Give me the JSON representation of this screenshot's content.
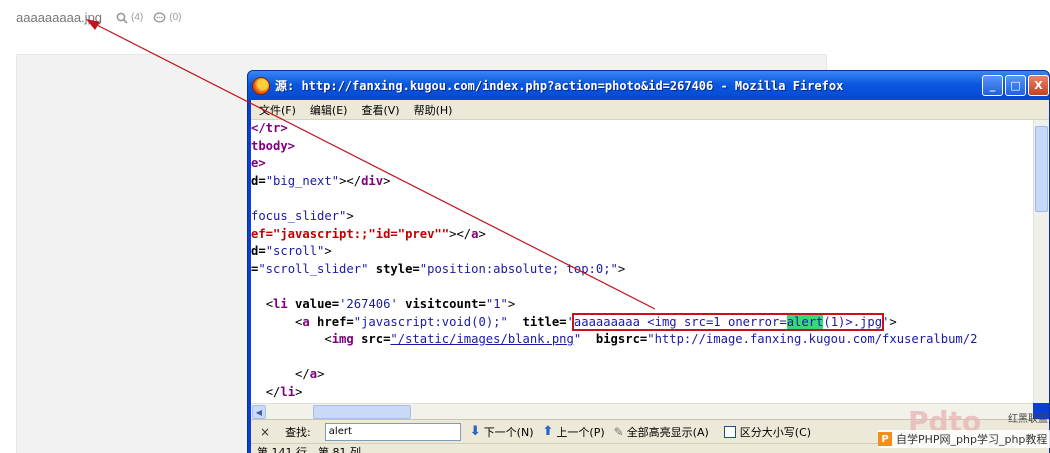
{
  "page": {
    "title": "aaaaaaaaa.jpg",
    "views_count": "(4)",
    "comments_count": "(0)"
  },
  "window": {
    "title": "源: http://fanxing.kugou.com/index.php?action=photo&id=267406 - Mozilla Firefox",
    "minimize_label": "_",
    "maximize_label": "□",
    "close_label": "X",
    "menu": [
      "文件(F)",
      "编辑(E)",
      "查看(V)",
      "帮助(H)"
    ]
  },
  "source": {
    "l1_tag": "</tr>",
    "l2_tag": "tbody>",
    "l3_tag": "e>",
    "l4_a": "d=",
    "l4_b": "\"big_next\"",
    "l4_c": "></",
    "l4_d": "div",
    "l4_e": ">",
    "l5_a": "focus_slider\"",
    "l5_b": ">",
    "l6_a": "ef=\"javascript:;\"id=\"prev\"\"",
    "l6_b": "></",
    "l6_c": "a",
    "l6_d": ">",
    "l7_a": "d=",
    "l7_b": "\"scroll\"",
    "l7_c": ">",
    "l8_a": "=",
    "l8_b": "\"scroll_slider\"",
    "l8_c": " style=",
    "l8_d": "\"position:absolute; top:0;\"",
    "l8_e": ">",
    "l9_a": "<",
    "l9_b": "li",
    "l9_c": " value=",
    "l9_d": "'267406'",
    "l9_e": " visitcount=",
    "l9_f": "\"1\"",
    "l9_g": ">",
    "l10_a": "<",
    "l10_b": "a",
    "l10_c": " href=",
    "l10_d": "\"javascript:void(0);\"",
    "l10_e": "  title=",
    "l10_f": "'",
    "l10_g": "aaaaaaaaa <img src=1 onerror=",
    "l10_hl": "alert",
    "l10_h": "(1)>.jpg",
    "l10_i": "'",
    "l10_j": ">",
    "l11_a": "<",
    "l11_b": "img",
    "l11_c": " src=",
    "l11_d": "\"/static/images/blank.png",
    "l11_e": "\"",
    "l11_f": "  bigsrc=",
    "l11_g": "\"http://image.fanxing.kugou.com/fxuseralbum/2",
    "l12_a": "</",
    "l12_b": "a",
    "l12_c": ">",
    "l13_a": "</",
    "l13_b": "li",
    "l13_c": ">"
  },
  "findbar": {
    "close": "×",
    "label": "查找:",
    "value": "alert",
    "next_label": "下一个(N)",
    "prev_label": "上一个(P)",
    "highlight_label": "全部高亮显示(A)",
    "case_label": "区分大小写(C)"
  },
  "statusbar": {
    "text": "第 141 行，第 81 列"
  },
  "watermark": {
    "logo_text": "Pdto",
    "side_text_1": "红黑联盟",
    "side_text_2": "",
    "bottom_text": "自学PHP网_php学习_php教程"
  },
  "colors": {
    "annotation": "#c0151c",
    "titlebar": "#0b58e0",
    "highlight": "#38d878"
  }
}
